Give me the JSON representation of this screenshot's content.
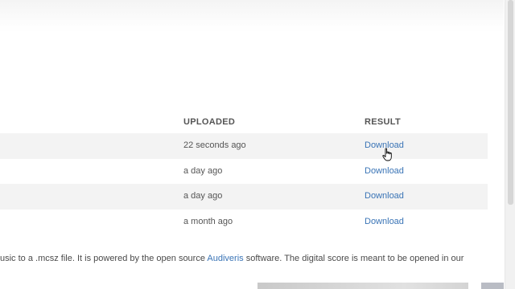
{
  "table": {
    "headers": {
      "uploaded": "UPLOADED",
      "result": "RESULT"
    },
    "rows": [
      {
        "uploaded": "22 seconds ago",
        "result": "Download"
      },
      {
        "uploaded": "a day ago",
        "result": "Download"
      },
      {
        "uploaded": "a day ago",
        "result": "Download"
      },
      {
        "uploaded": "a month ago",
        "result": "Download"
      }
    ]
  },
  "footer": {
    "text_before": "usic to a .mcsz file. It is powered by the open source ",
    "link": "Audiveris",
    "text_after": " software. The digital score is meant to be opened in our"
  },
  "colors": {
    "link": "#3a74b6",
    "stripe": "#f3f3f3",
    "text": "#4a4a4a"
  },
  "cursor": {
    "icon": "hand-pointer-icon"
  }
}
